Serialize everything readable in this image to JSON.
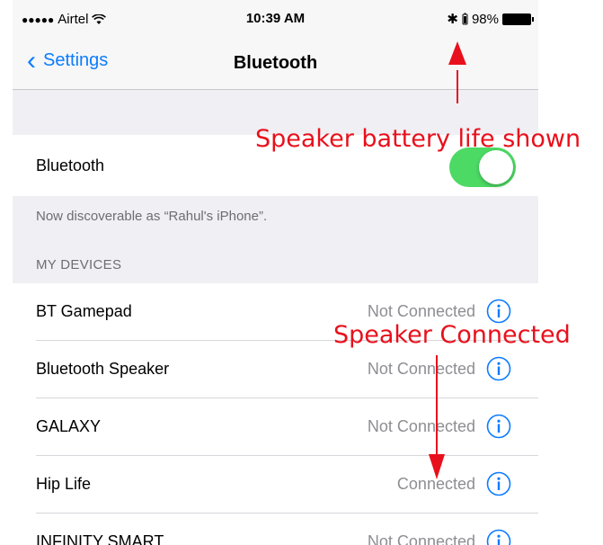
{
  "status_bar": {
    "signal_dots": "●●●●●",
    "carrier": "Airtel",
    "time": "10:39 AM",
    "bt_glyph": "✱",
    "battery_percent": "98%"
  },
  "nav": {
    "back_label": "Settings",
    "title": "Bluetooth"
  },
  "bluetooth_toggle": {
    "label": "Bluetooth",
    "on": true
  },
  "discoverable_note": "Now discoverable as “Rahul's iPhone”.",
  "devices_header": "MY DEVICES",
  "devices": [
    {
      "name": "BT Gamepad",
      "status": "Not Connected"
    },
    {
      "name": "Bluetooth Speaker",
      "status": "Not Connected"
    },
    {
      "name": "GALAXY",
      "status": "Not Connected"
    },
    {
      "name": "Hip Life",
      "status": "Connected"
    },
    {
      "name": "INFINITY SMART",
      "status": "Not Connected"
    }
  ],
  "annotations": {
    "battery_note": "Speaker battery life shown",
    "connected_note": "Speaker Connected"
  },
  "colors": {
    "accent": "#0b7cff",
    "toggle_on": "#4cd964",
    "annotation": "#e8101c"
  }
}
